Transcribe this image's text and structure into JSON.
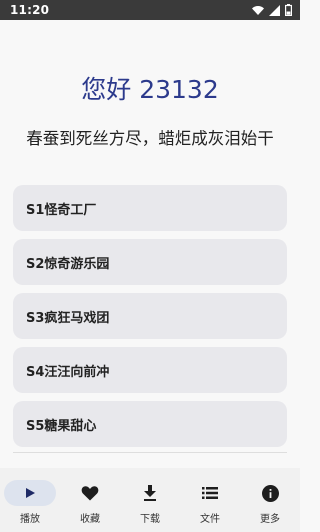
{
  "status_bar": {
    "time": "11:20",
    "icons": [
      "wifi-icon",
      "signal-icon",
      "battery-icon"
    ]
  },
  "greeting": "您好 23132",
  "subtitle": "春蚕到死丝方尽，蜡炬成灰泪始干",
  "seasons": [
    {
      "label": "S1怪奇工厂"
    },
    {
      "label": "S2惊奇游乐园"
    },
    {
      "label": "S3疯狂马戏团"
    },
    {
      "label": "S4汪汪向前冲"
    },
    {
      "label": "S5糖果甜心"
    }
  ],
  "nav": [
    {
      "label": "播放",
      "icon": "play-icon",
      "active": true
    },
    {
      "label": "收藏",
      "icon": "heart-icon",
      "active": false
    },
    {
      "label": "下载",
      "icon": "download-icon",
      "active": false
    },
    {
      "label": "文件",
      "icon": "list-icon",
      "active": false
    },
    {
      "label": "更多",
      "icon": "info-icon",
      "active": false
    }
  ],
  "colors": {
    "accent": "#2c3a8c",
    "status_bar": "#3a3a3a",
    "card": "#e8e8ec",
    "nav_active_pill": "#dde3ee"
  }
}
